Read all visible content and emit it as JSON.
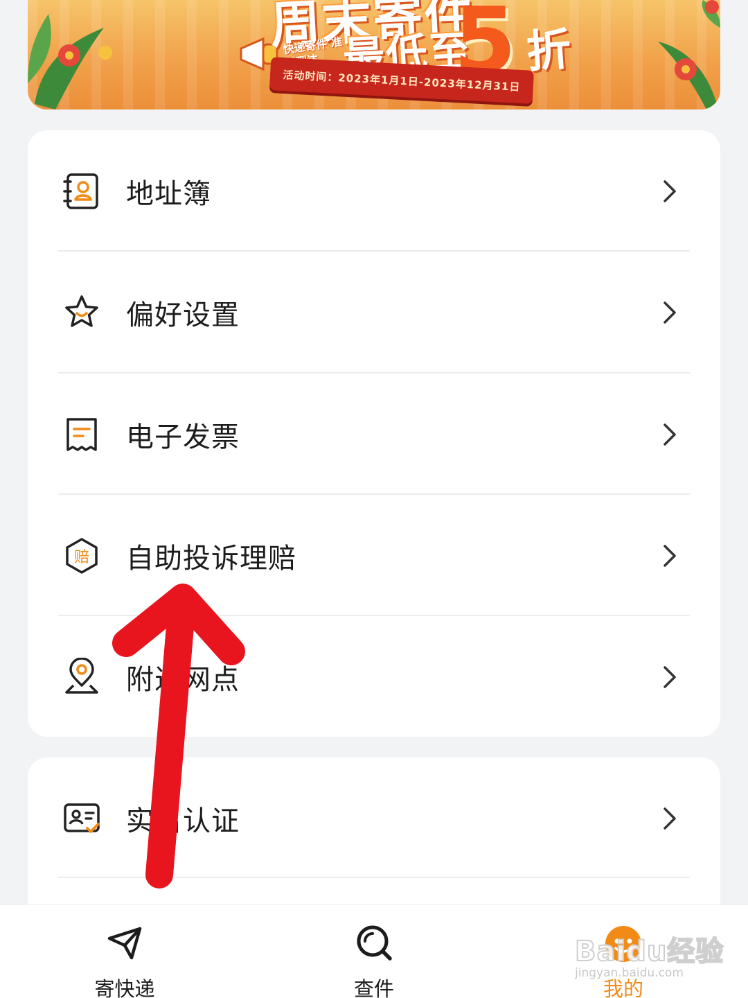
{
  "banner": {
    "headline": "周末寄件",
    "promo_line": "最低至",
    "promo_number": "5",
    "promo_suffix": "折",
    "megaphone_text": "快递寄件 准时到达",
    "ribbon_text": "活动时间：2023年1月1日-2023年12月31日"
  },
  "menu_primary": [
    {
      "label": "地址簿",
      "icon": "address-book-icon"
    },
    {
      "label": "偏好设置",
      "icon": "star-icon"
    },
    {
      "label": "电子发票",
      "icon": "invoice-icon"
    },
    {
      "label": "自助投诉理赔",
      "icon": "compensation-icon"
    },
    {
      "label": "附近网点",
      "icon": "location-pin-icon"
    }
  ],
  "menu_secondary": [
    {
      "label": "实名认证",
      "icon": "id-verify-icon"
    }
  ],
  "tabbar": {
    "items": [
      {
        "label": "寄快递",
        "icon": "send-plane-icon",
        "active": false
      },
      {
        "label": "查件",
        "icon": "search-icon",
        "active": false
      },
      {
        "label": "我的",
        "icon": "profile-icon",
        "active": true
      }
    ]
  },
  "watermark": {
    "brand": "Baidu经验",
    "url": "jingyan.baidu.com"
  },
  "colors": {
    "accent": "#f28a16",
    "annotation_arrow": "#e8141e",
    "background": "#f2f3f5"
  }
}
